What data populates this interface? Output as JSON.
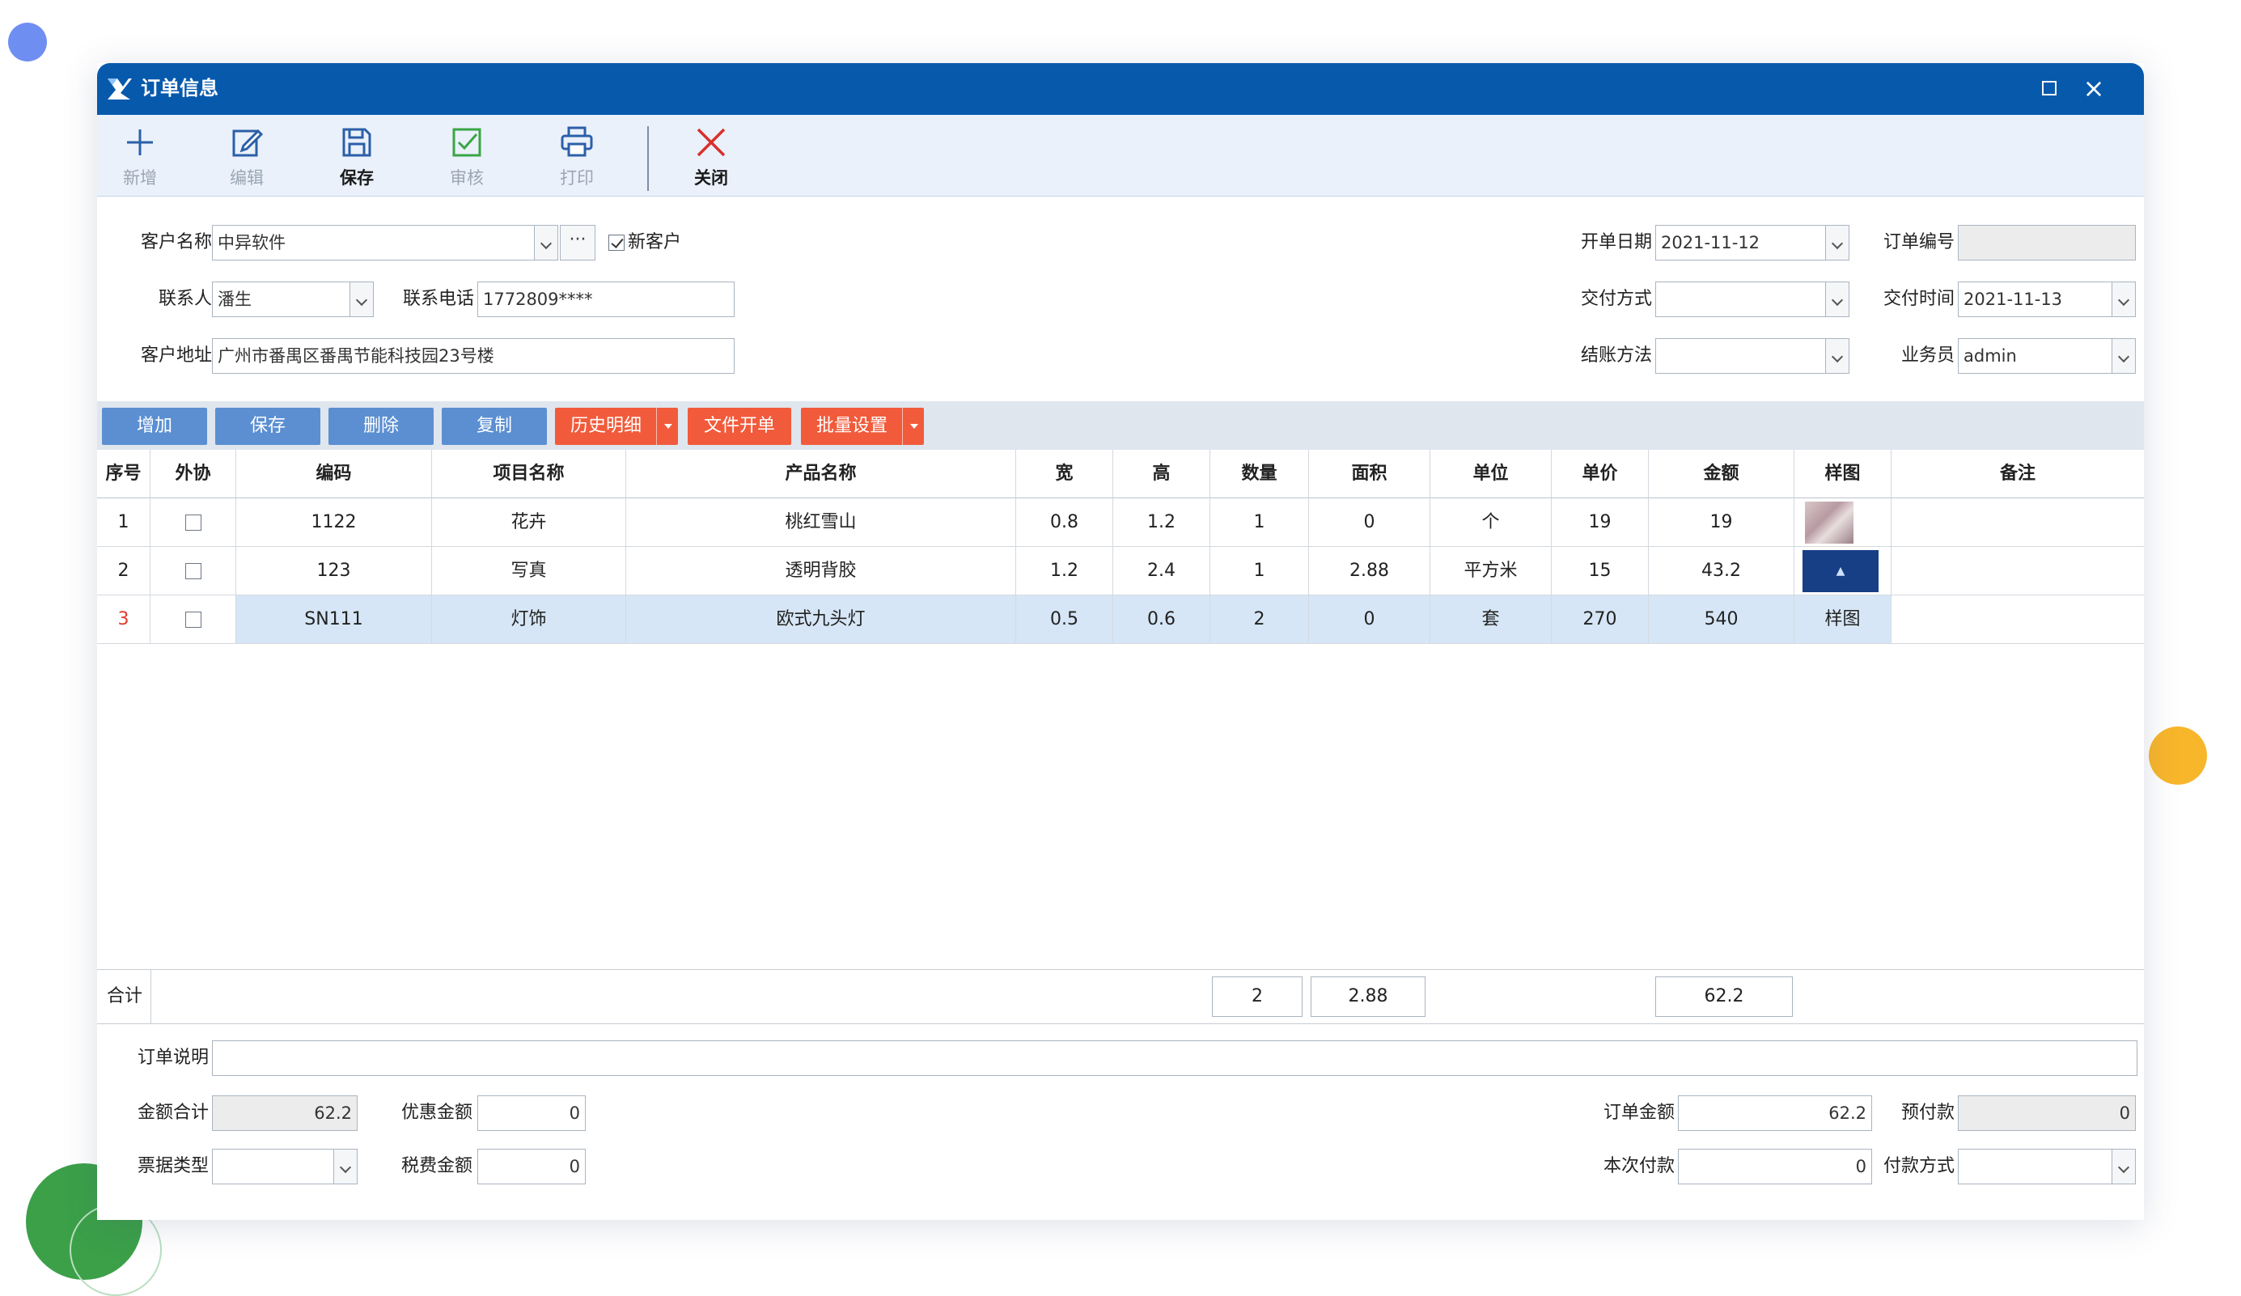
{
  "window": {
    "title": "订单信息"
  },
  "toolbar": {
    "new": "新增",
    "edit": "编辑",
    "save": "保存",
    "audit": "审核",
    "print": "打印",
    "close": "关闭"
  },
  "form": {
    "customer_name_label": "客户名称",
    "customer_name": "中异软件",
    "new_customer_label": "新客户",
    "new_customer_checked": true,
    "contact_label": "联系人",
    "contact": "潘生",
    "phone_label": "联系电话",
    "phone": "1772809****",
    "address_label": "客户地址",
    "address": "广州市番禺区番禺节能科技园23号楼",
    "open_date_label": "开单日期",
    "open_date": "2021-11-12",
    "order_no_label": "订单编号",
    "order_no": "",
    "delivery_method_label": "交付方式",
    "delivery_method": "",
    "delivery_time_label": "交付时间",
    "delivery_time": "2021-11-13",
    "settlement_label": "结账方法",
    "settlement": "",
    "salesperson_label": "业务员",
    "salesperson": "admin"
  },
  "grid_actions": {
    "add": "增加",
    "save": "保存",
    "delete": "删除",
    "copy": "复制",
    "history": "历史明细",
    "file_order": "文件开单",
    "batch": "批量设置"
  },
  "grid": {
    "headers": [
      "序号",
      "外协",
      "编码",
      "项目名称",
      "产品名称",
      "宽",
      "高",
      "数量",
      "面积",
      "单位",
      "单价",
      "金额",
      "样图",
      "备注"
    ],
    "rows": [
      {
        "no": "1",
        "code": "1122",
        "item": "花卉",
        "product": "桃红雪山",
        "w": "0.8",
        "h": "1.2",
        "qty": "1",
        "area": "0",
        "unit": "个",
        "price": "19",
        "amount": "19",
        "sample": "",
        "note": ""
      },
      {
        "no": "2",
        "code": "123",
        "item": "写真",
        "product": "透明背胶",
        "w": "1.2",
        "h": "2.4",
        "qty": "1",
        "area": "2.88",
        "unit": "平方米",
        "price": "15",
        "amount": "43.2",
        "sample": "",
        "note": ""
      },
      {
        "no": "3",
        "code": "SN111",
        "item": "灯饰",
        "product": "欧式九头灯",
        "w": "0.5",
        "h": "0.6",
        "qty": "2",
        "area": "0",
        "unit": "套",
        "price": "270",
        "amount": "540",
        "sample": "样图",
        "note": ""
      }
    ]
  },
  "totals": {
    "label": "合计",
    "qty": "2",
    "area": "2.88",
    "amount": "62.2"
  },
  "footer": {
    "remark_label": "订单说明",
    "remark": "",
    "sum_label": "金额合计",
    "sum": "62.2",
    "discount_label": "优惠金额",
    "discount": "0",
    "invoice_label": "票据类型",
    "invoice": "",
    "tax_label": "税费金额",
    "tax": "0",
    "order_amount_label": "订单金额",
    "order_amount": "62.2",
    "prepay_label": "预付款",
    "prepay": "0",
    "pay_now_label": "本次付款",
    "pay_now": "0",
    "pay_method_label": "付款方式",
    "pay_method": ""
  },
  "colors": {
    "titlebar": "#0759ac",
    "toolbar_bg": "#eaf1fb",
    "action_blue": "#5b8fd2",
    "action_red": "#f15b3b",
    "selected_row": "#d6e6f6"
  }
}
